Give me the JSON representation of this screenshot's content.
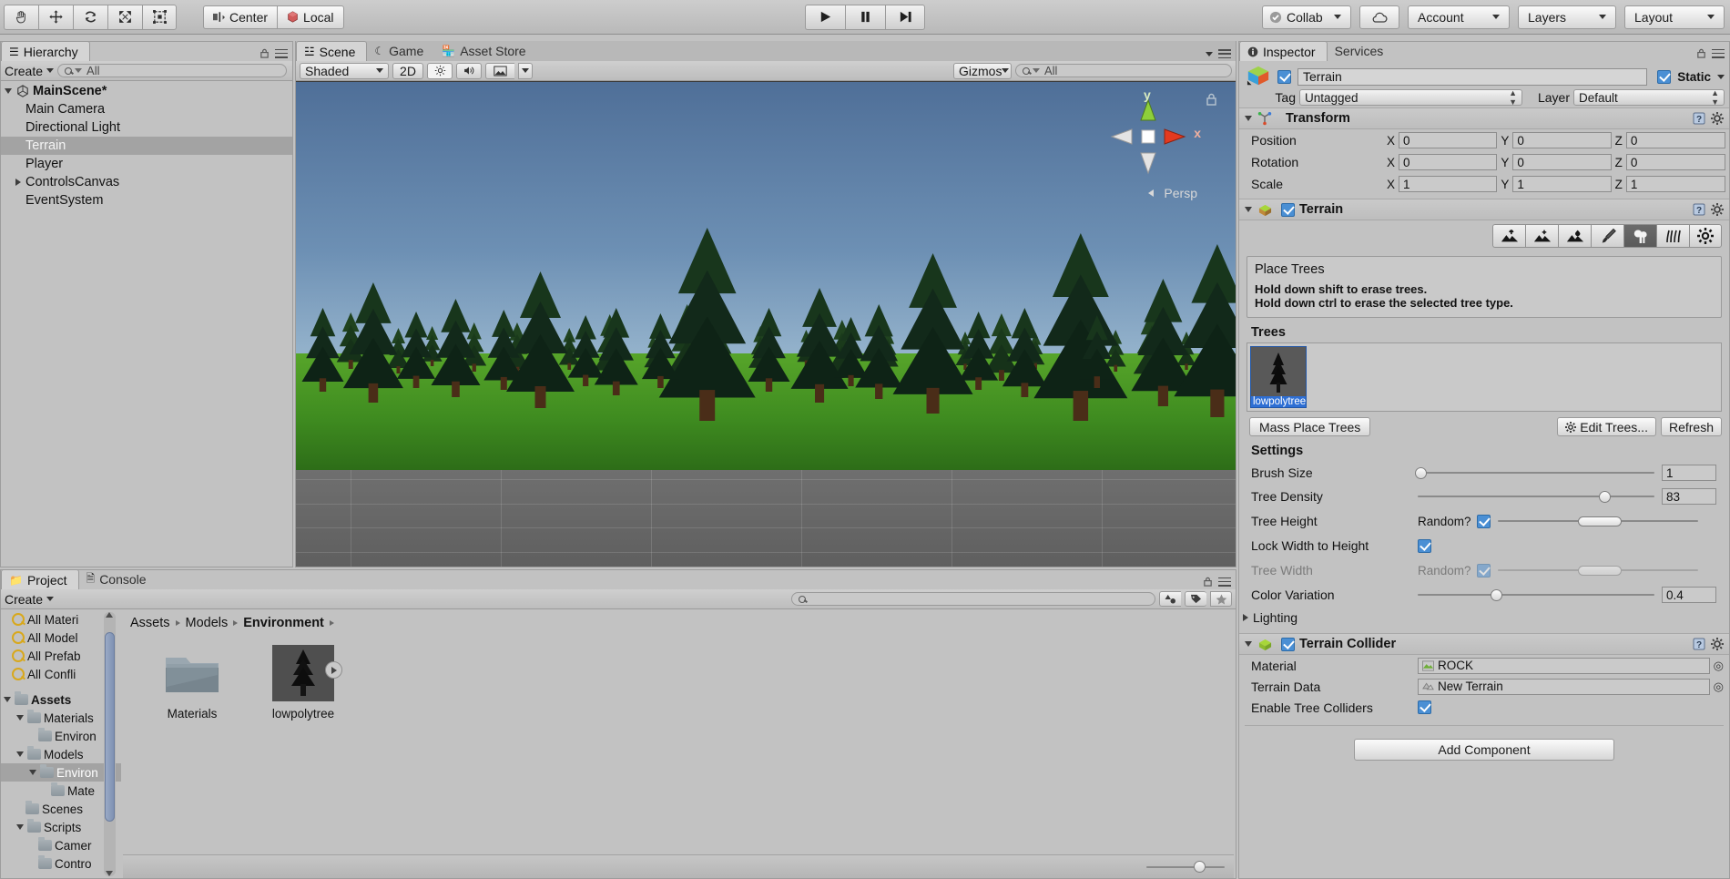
{
  "toolbar": {
    "tools": [
      {
        "name": "hand-tool",
        "glyph": "✋"
      },
      {
        "name": "move-tool",
        "glyph": "✥"
      },
      {
        "name": "rotate-tool",
        "glyph": "↻"
      },
      {
        "name": "scale-tool",
        "glyph": "⤢"
      },
      {
        "name": "rect-tool",
        "glyph": "⬚"
      }
    ],
    "pivot_label": "Center",
    "space_label": "Local",
    "play_label": "▶",
    "pause_label": "❚❚",
    "step_label": "▶▏",
    "collab_label": "Collab",
    "cloud_label": "cloud-icon",
    "account_label": "Account",
    "layers_label": "Layers",
    "layout_label": "Layout"
  },
  "hierarchy": {
    "tab_label": "Hierarchy",
    "create_label": "Create",
    "search_placeholder": "All",
    "scene_name": "MainScene*",
    "items": [
      {
        "label": "Main Camera",
        "indent": 1,
        "expandable": false,
        "selected": false
      },
      {
        "label": "Directional Light",
        "indent": 1,
        "expandable": false,
        "selected": false
      },
      {
        "label": "Terrain",
        "indent": 1,
        "expandable": false,
        "selected": true
      },
      {
        "label": "Player",
        "indent": 1,
        "expandable": false,
        "selected": false
      },
      {
        "label": "ControlsCanvas",
        "indent": 1,
        "expandable": true,
        "selected": false
      },
      {
        "label": "EventSystem",
        "indent": 1,
        "expandable": false,
        "selected": false
      }
    ]
  },
  "scene": {
    "tabs": [
      {
        "label": "Scene",
        "active": true
      },
      {
        "label": "Game",
        "active": false
      },
      {
        "label": "Asset Store",
        "active": false
      }
    ],
    "shading_mode": "Shaded",
    "mode_2d": "2D",
    "lighting_icon": "sun-icon",
    "audio_icon": "speaker-icon",
    "effects_icon": "image-icon",
    "gizmos_label": "Gizmos",
    "search_placeholder": "All",
    "axis_x": "x",
    "axis_y": "y",
    "perspective_label": "Persp"
  },
  "project": {
    "tabs": [
      {
        "label": "Project",
        "active": true
      },
      {
        "label": "Console",
        "active": false
      }
    ],
    "create_label": "Create",
    "search_placeholder": "",
    "filters": [
      {
        "label": "All Materi",
        "icon": "search-filter-icon"
      },
      {
        "label": "All Model",
        "icon": "search-filter-icon"
      },
      {
        "label": "All Prefab",
        "icon": "search-filter-icon"
      },
      {
        "label": "All Confli",
        "icon": "search-filter-icon"
      }
    ],
    "tree": [
      {
        "label": "Assets",
        "indent": 0,
        "expandable": true,
        "expanded": true,
        "bold": true,
        "selected": false
      },
      {
        "label": "Materials",
        "indent": 1,
        "expandable": true,
        "expanded": true,
        "bold": false,
        "selected": false
      },
      {
        "label": "Environ",
        "indent": 2,
        "expandable": false,
        "expanded": false,
        "bold": false,
        "selected": false
      },
      {
        "label": "Models",
        "indent": 1,
        "expandable": true,
        "expanded": true,
        "bold": false,
        "selected": false
      },
      {
        "label": "Environ",
        "indent": 2,
        "expandable": true,
        "expanded": true,
        "bold": false,
        "selected": true
      },
      {
        "label": "Mate",
        "indent": 3,
        "expandable": false,
        "expanded": false,
        "bold": false,
        "selected": false
      },
      {
        "label": "Scenes",
        "indent": 1,
        "expandable": false,
        "expanded": false,
        "bold": false,
        "selected": false
      },
      {
        "label": "Scripts",
        "indent": 1,
        "expandable": true,
        "expanded": true,
        "bold": false,
        "selected": false
      },
      {
        "label": "Camer",
        "indent": 2,
        "expandable": false,
        "expanded": false,
        "bold": false,
        "selected": false
      },
      {
        "label": "Contro",
        "indent": 2,
        "expandable": false,
        "expanded": false,
        "bold": false,
        "selected": false
      }
    ],
    "breadcrumb": [
      "Assets",
      "Models",
      "Environment"
    ],
    "assets": [
      {
        "label": "Materials",
        "type": "folder"
      },
      {
        "label": "lowpolytree",
        "type": "model"
      }
    ]
  },
  "inspector": {
    "tabs": [
      {
        "label": "Inspector",
        "active": true
      },
      {
        "label": "Services",
        "active": false
      }
    ],
    "object_name": "Terrain",
    "object_enabled": true,
    "static_label": "Static",
    "static_checked": true,
    "tag_label": "Tag",
    "tag_value": "Untagged",
    "layer_label": "Layer",
    "layer_value": "Default",
    "transform": {
      "title": "Transform",
      "rows": [
        {
          "label": "Position",
          "x": "0",
          "y": "0",
          "z": "0"
        },
        {
          "label": "Rotation",
          "x": "0",
          "y": "0",
          "z": "0"
        },
        {
          "label": "Scale",
          "x": "1",
          "y": "1",
          "z": "1"
        }
      ],
      "axis_labels": [
        "X",
        "Y",
        "Z"
      ]
    },
    "terrain": {
      "title": "Terrain",
      "enabled": true,
      "tools": [
        {
          "name": "raise-lower-terrain-icon",
          "active": false
        },
        {
          "name": "paint-height-icon",
          "active": false
        },
        {
          "name": "smooth-height-icon",
          "active": false
        },
        {
          "name": "paint-texture-icon",
          "active": false
        },
        {
          "name": "place-trees-icon",
          "active": true
        },
        {
          "name": "paint-details-icon",
          "active": false
        },
        {
          "name": "terrain-settings-icon",
          "active": false
        }
      ],
      "help_title": "Place Trees",
      "help_lines": [
        "Hold down shift to erase trees.",
        "Hold down ctrl to erase the selected tree type."
      ],
      "trees_label": "Trees",
      "tree_items": [
        {
          "label": "lowpolytree",
          "selected": true
        }
      ],
      "mass_place_label": "Mass Place Trees",
      "edit_trees_label": "Edit Trees...",
      "refresh_label": "Refresh",
      "settings_label": "Settings",
      "brush_size_label": "Brush Size",
      "brush_size_value": "1",
      "brush_size_pct": 1,
      "tree_density_label": "Tree Density",
      "tree_density_value": "83",
      "tree_density_pct": 79,
      "tree_height_label": "Tree Height",
      "tree_height_random_label": "Random?",
      "tree_height_random": true,
      "tree_height_range": [
        40,
        62
      ],
      "lock_width_label": "Lock Width to Height",
      "lock_width_checked": true,
      "tree_width_label": "Tree Width",
      "tree_width_random_label": "Random?",
      "tree_width_random": true,
      "tree_width_range": [
        40,
        62
      ],
      "color_variation_label": "Color Variation",
      "color_variation_value": "0.4",
      "color_variation_pct": 33,
      "lighting_label": "Lighting"
    },
    "terrain_collider": {
      "title": "Terrain Collider",
      "enabled": true,
      "material_label": "Material",
      "material_value": "ROCK",
      "terrain_data_label": "Terrain Data",
      "terrain_data_value": "New Terrain",
      "enable_tree_colliders_label": "Enable Tree Colliders",
      "enable_tree_colliders_checked": true
    },
    "add_component_label": "Add Component"
  },
  "colors": {
    "accent_blue": "#2e6fd4",
    "chrome": "#c2c2c2",
    "selected_row": "#a3a3a3"
  }
}
